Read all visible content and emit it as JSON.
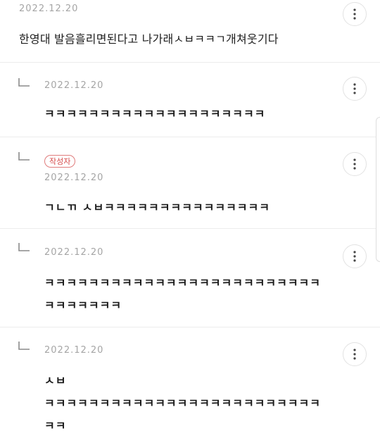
{
  "comments": [
    {
      "date": "2022.12.20",
      "lines": [
        "한영대 발음흘리면된다고 나가래ㅅㅂㅋㅋㄱ개쳐웃기다"
      ]
    },
    {
      "date": "2022.12.20",
      "lines": [
        "ㅋㅋㅋㅋㅋㅋㅋㅋㅋㅋㅋㅋㅋㅋㅋㅋㅋㅋㅋㅋ"
      ]
    },
    {
      "badge": "작성자",
      "date": "2022.12.20",
      "lines": [
        "ㄱㄴㄲ ㅅㅂㅋㅋㅋㅋㅋㅋㅋㅋㅋㅋㅋㅋㅋㅋㅋ"
      ]
    },
    {
      "date": "2022.12.20",
      "lines": [
        "ㅋㅋㅋㅋㅋㅋㅋㅋㅋㅋㅋㅋㅋㅋㅋㅋㅋㅋㅋㅋㅋㅋㅋㅋㅋ",
        "ㅋㅋㅋㅋㅋㅋㅋ"
      ]
    },
    {
      "date": "2022.12.20",
      "lines": [
        "ㅅㅂ",
        "ㅋㅋㅋㅋㅋㅋㅋㅋㅋㅋㅋㅋㅋㅋㅋㅋㅋㅋㅋㅋㅋㅋㅋㅋㅋ",
        "ㅋㅋ"
      ]
    }
  ],
  "icons": {
    "more": "more-vertical-icon",
    "reply": "reply-arrow-icon"
  },
  "colors": {
    "badge_border": "#e07c7c",
    "badge_text": "#d64a4a",
    "date_text": "#a5a5a5",
    "divider": "#ececec"
  }
}
